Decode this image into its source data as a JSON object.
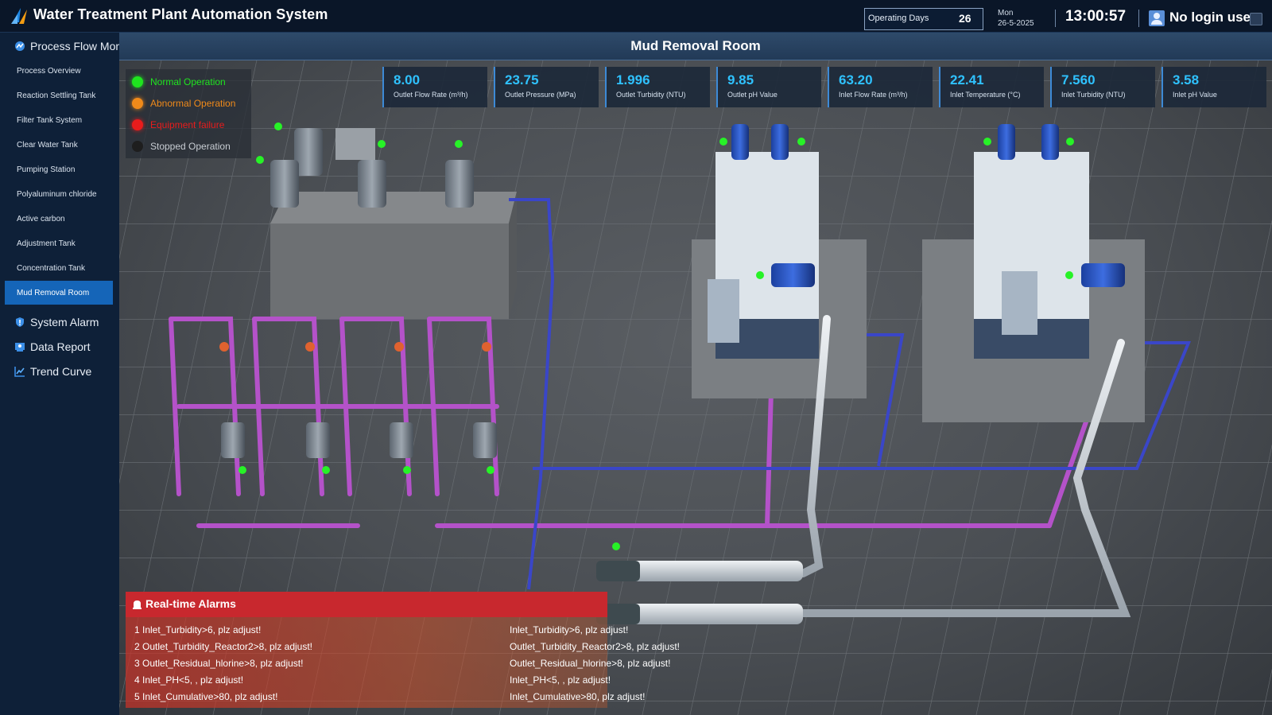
{
  "header": {
    "app_title": "Water Treatment Plant Automation System",
    "operating_days_label": "Operating Days",
    "operating_days_value": "26",
    "weekday": "Mon",
    "date": "26-5-2025",
    "time": "13:00:57",
    "user_label": "No login user"
  },
  "sidebar": {
    "process_flow": "Process Flow Mon",
    "items": [
      {
        "label": "Process Overview"
      },
      {
        "label": "Reaction Settling Tank"
      },
      {
        "label": "Filter Tank System"
      },
      {
        "label": "Clear Water Tank"
      },
      {
        "label": "Pumping Station"
      },
      {
        "label": "Polyaluminum chloride"
      },
      {
        "label": "Active carbon"
      },
      {
        "label": "Adjustment Tank"
      },
      {
        "label": "Concentration Tank"
      },
      {
        "label": "Mud Removal Room"
      }
    ],
    "active_item": "Mud Removal Room",
    "system_alarm": "System Alarm",
    "data_report": "Data Report",
    "trend_curve": "Trend Curve"
  },
  "room_title": "Mud Removal Room",
  "legend": [
    {
      "label": "Normal Operation",
      "color": "#1fe51f"
    },
    {
      "label": "Abnormal Operation",
      "color": "#f08a1a"
    },
    {
      "label": "Equipment failure",
      "color": "#e81c1c"
    },
    {
      "label": "Stopped Operation",
      "color": "#1e1e1e"
    }
  ],
  "metrics": [
    {
      "value": "8.00",
      "label": "Outlet Flow Rate (m³/h)"
    },
    {
      "value": "23.75",
      "label": "Outlet Pressure (MPa)"
    },
    {
      "value": "1.996",
      "label": "Outlet Turbidity (NTU)"
    },
    {
      "value": "9.85",
      "label": "Outlet pH Value"
    },
    {
      "value": "63.20",
      "label": "Inlet Flow Rate (m³/h)"
    },
    {
      "value": "22.41",
      "label": "Inlet Temperature (°C)"
    },
    {
      "value": "7.560",
      "label": "Inlet Turbidity (NTU)"
    },
    {
      "value": "3.58",
      "label": "Inlet pH Value"
    }
  ],
  "alarms": {
    "title": "Real-time Alarms",
    "left": [
      "1  Inlet_Turbidity>6,  plz adjust!",
      "2  Outlet_Turbidity_Reactor2>8,  plz adjust!",
      "3  Outlet_Residual_hlorine>8,  plz adjust!",
      "4  Inlet_PH<5,  ,  plz adjust!",
      "5  Inlet_Cumulative>80,  plz adjust!"
    ],
    "right": [
      "Inlet_Turbidity>6,  plz adjust!",
      "Outlet_Turbidity_Reactor2>8,  plz adjust!",
      "Outlet_Residual_hlorine>8,  plz adjust!",
      "Inlet_PH<5,  ,  plz adjust!",
      "Inlet_Cumulative>80,  plz adjust!"
    ]
  },
  "colors": {
    "accent": "#1565b8",
    "metric_value": "#2fc2ff",
    "alarm": "#c8282e",
    "status_ok": "#1fe51f"
  }
}
